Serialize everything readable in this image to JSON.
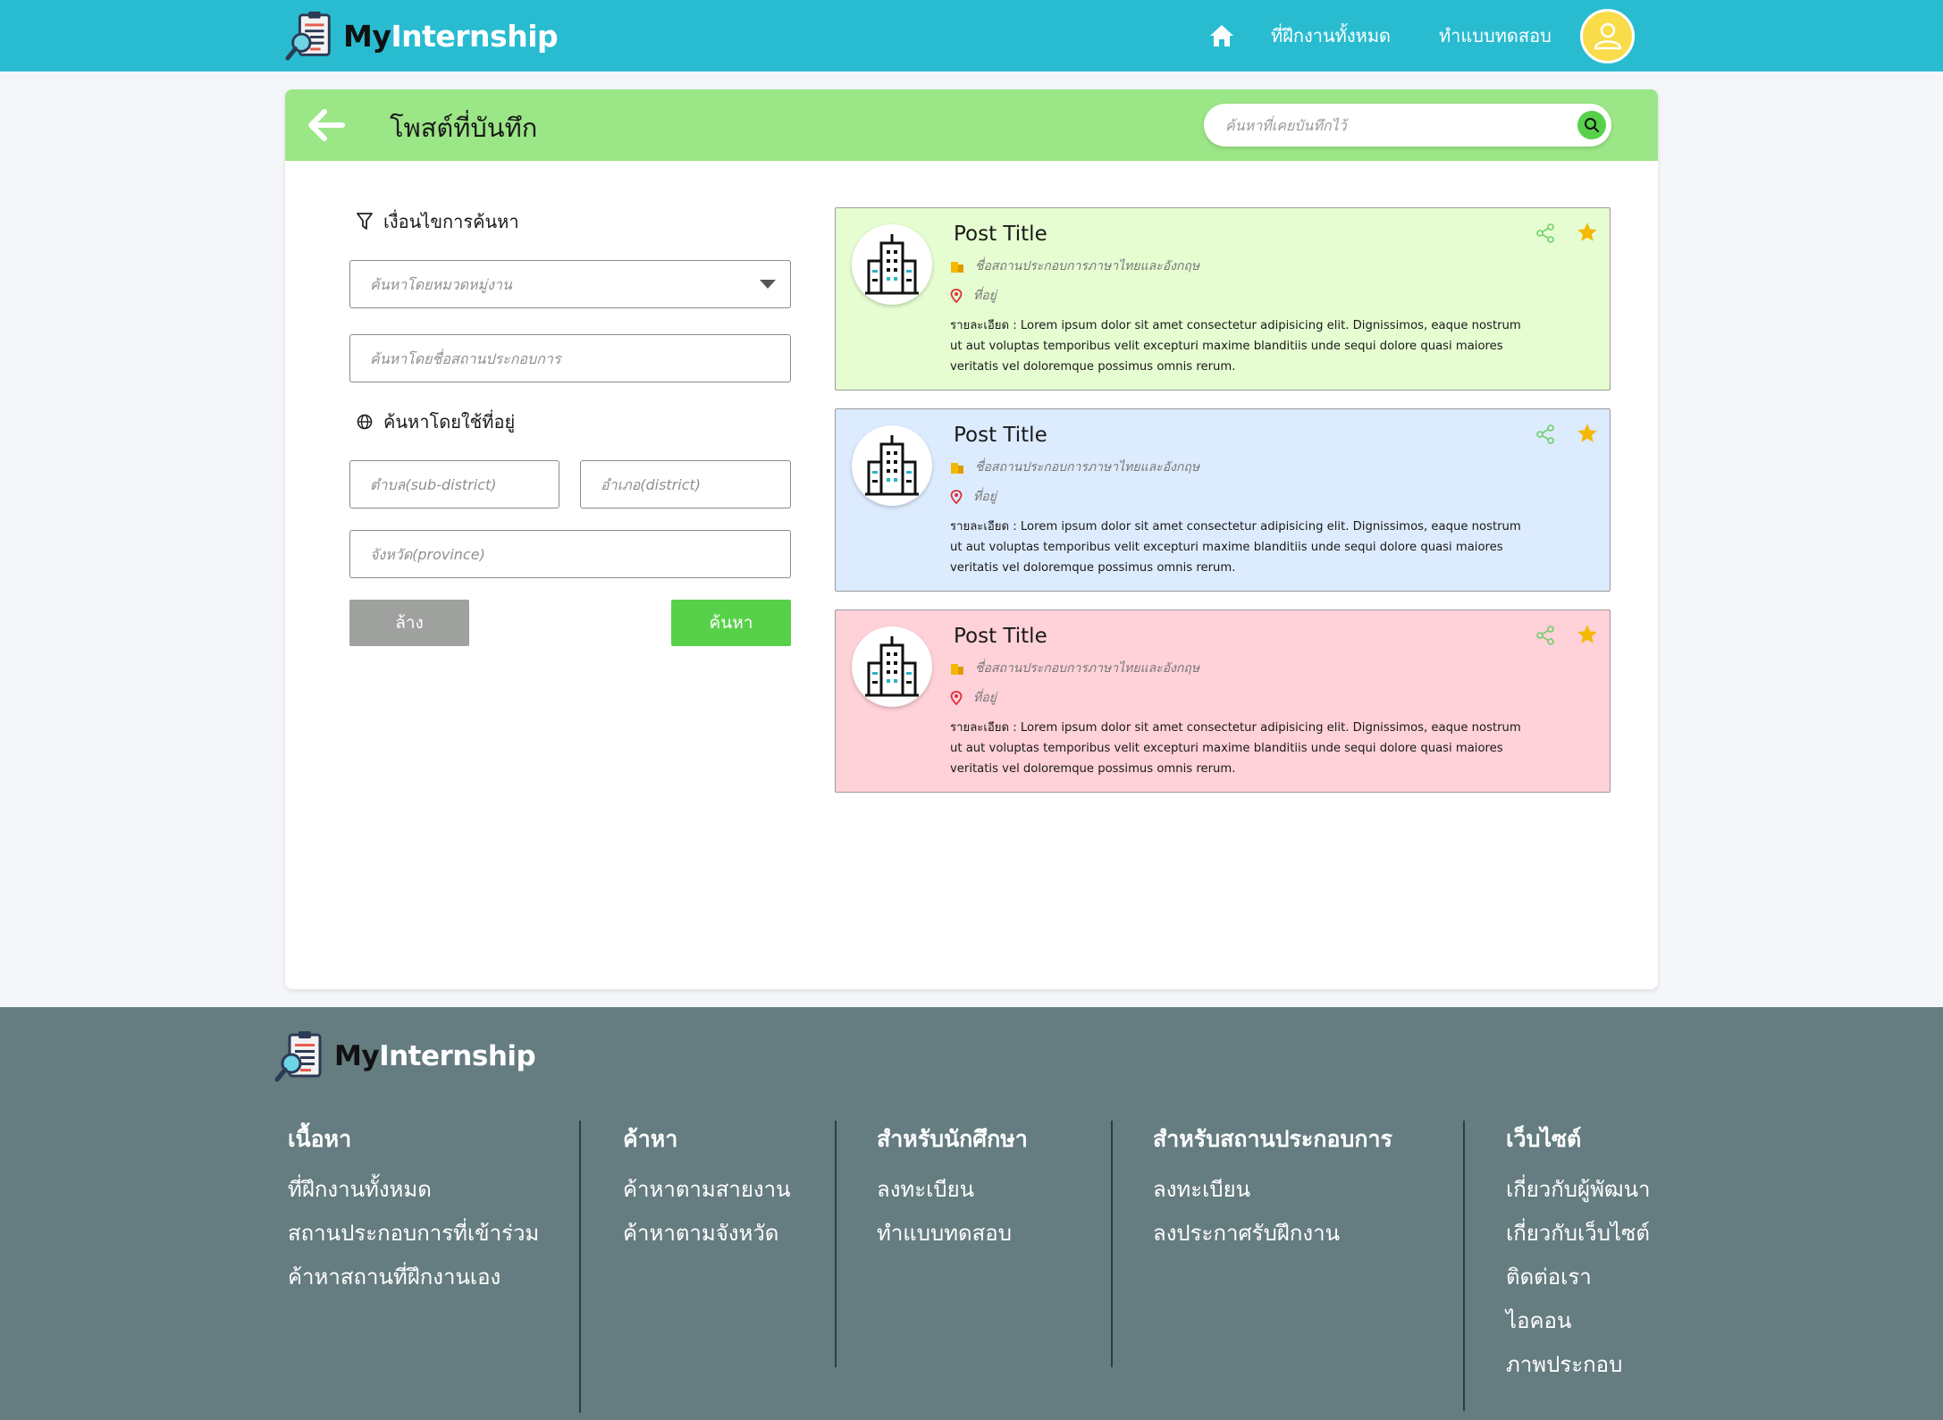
{
  "brand": {
    "my": "My",
    "internship": "Internship"
  },
  "nav": {
    "all_internships": "ที่ฝึกงานทั้งหมด",
    "quiz": "ทำแบบทดสอบ"
  },
  "header": {
    "title": "โพสต์ที่บันทึก",
    "search_placeholder": "ค้นหาที่เคยบันทึกไว้"
  },
  "filters": {
    "title": "เงื่อนไขการค้นหา",
    "category_placeholder": "ค้นหาโดยหมวดหมู่งาน",
    "company_placeholder": "ค้นหาโดยชื่อสถานประกอบการ",
    "address_title": "ค้นหาโดยใช้ที่อยู่",
    "subdistrict_placeholder": "ตำบล(sub-district)",
    "district_placeholder": "อำเภอ(district)",
    "province_placeholder": "จังหวัด(province)",
    "clear_label": "ล้าง",
    "search_label": "ค้นหา"
  },
  "posts": [
    {
      "title": "Post Title",
      "company": "ชื่อสถานประกอบการภาษาไทยและอังกฤษ",
      "address": "ที่อยู่",
      "description": "รายละเอียด : Lorem ipsum dolor sit amet consectetur adipisicing elit. Dignissimos, eaque nostrum ut aut voluptas temporibus velit excepturi maxime blanditiis unde sequi dolore quasi maiores veritatis vel doloremque possimus omnis rerum.",
      "color": "#e5fdd1"
    },
    {
      "title": "Post Title",
      "company": "ชื่อสถานประกอบการภาษาไทยและอังกฤษ",
      "address": "ที่อยู่",
      "description": "รายละเอียด : Lorem ipsum dolor sit amet consectetur adipisicing elit. Dignissimos, eaque nostrum ut aut voluptas temporibus velit excepturi maxime blanditiis unde sequi dolore quasi maiores veritatis vel doloremque possimus omnis rerum.",
      "color": "#dcebfd"
    },
    {
      "title": "Post Title",
      "company": "ชื่อสถานประกอบการภาษาไทยและอังกฤษ",
      "address": "ที่อยู่",
      "description": "รายละเอียด : Lorem ipsum dolor sit amet consectetur adipisicing elit. Dignissimos, eaque nostrum ut aut voluptas temporibus velit excepturi maxime blanditiis unde sequi dolore quasi maiores veritatis vel doloremque possimus omnis rerum.",
      "color": "#ffd1d8"
    }
  ],
  "footer": {
    "columns": [
      {
        "heading": "เนื้อหา",
        "links": [
          "ที่ฝึกงานทั้งหมด",
          "สถานประกอบการที่เข้าร่วม",
          "ค้าหาสถานที่ฝึกงานเอง"
        ]
      },
      {
        "heading": "ค้าหา",
        "links": [
          "ค้าหาตามสายงาน",
          "ค้าหาตามจังหวัด"
        ]
      },
      {
        "heading": "สำหรับนักศึกษา",
        "links": [
          "ลงทะเบียน",
          "ทำแบบทดสอบ"
        ]
      },
      {
        "heading": "สำหรับสถานประกอบการ",
        "links": [
          "ลงทะเบียน",
          "ลงประกาศรับฝึกงาน"
        ]
      },
      {
        "heading": "เว็บไซต์",
        "links": [
          "เกี่ยวกับผู้พัฒนา",
          "เกี่ยวกับเว็บไซต์",
          "ติดต่อเรา",
          "ไอคอน",
          "ภาพประกอบ"
        ]
      }
    ]
  },
  "colors": {
    "navbar": "#29bcd1",
    "header_bar": "#9be686",
    "accent_green": "#58d14a",
    "clear_gray": "#9ea19d",
    "footer": "#657c80",
    "avatar": "#f9dc4a",
    "star": "#f5b800"
  },
  "icons": [
    "logo-icon",
    "home-icon",
    "user-icon",
    "back-arrow-icon",
    "search-icon",
    "filter-icon",
    "globe-icon",
    "dropdown-caret-icon",
    "building-icon",
    "company-icon",
    "location-pin-icon",
    "share-icon",
    "star-icon"
  ]
}
